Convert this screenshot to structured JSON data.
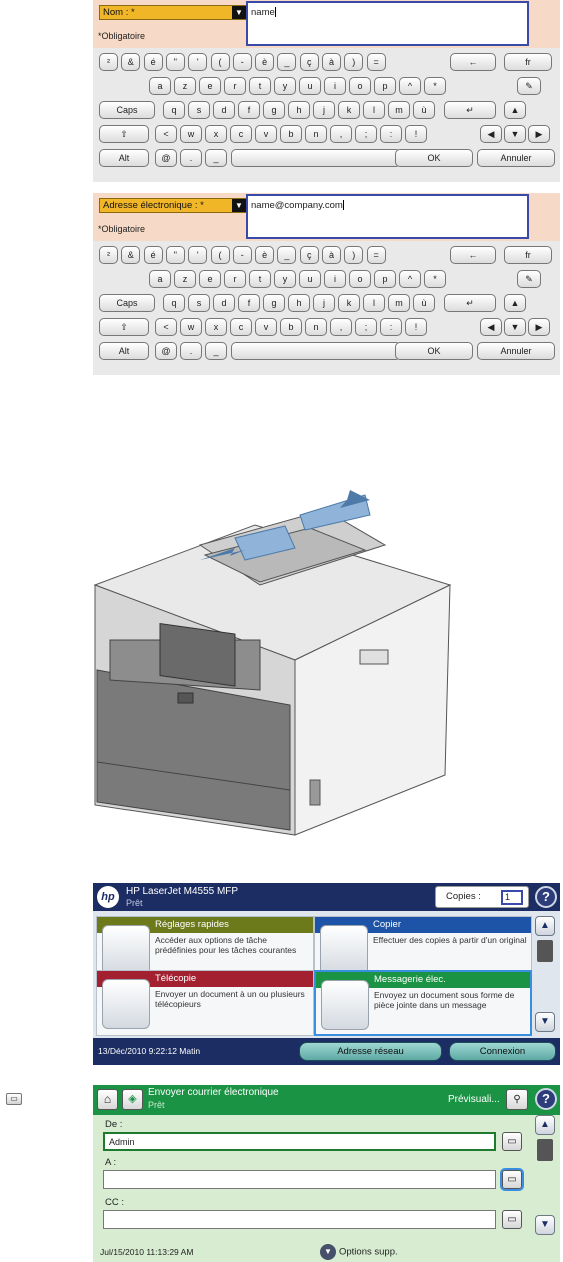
{
  "keyboard_panels": [
    {
      "field_label": "Nom : *",
      "field_value": "name",
      "required_note": "*Obligatoire"
    },
    {
      "field_label": "Adresse électronique : *",
      "field_value": "name@company.com",
      "required_note": "*Obligatoire"
    }
  ],
  "keyboard": {
    "row1": [
      "²",
      "&",
      "é",
      "\"",
      "'",
      "(",
      "-",
      "è",
      "_",
      "ç",
      "à",
      ")",
      "="
    ],
    "backspace": "←",
    "lang": "fr",
    "row2": [
      "a",
      "z",
      "e",
      "r",
      "t",
      "y",
      "u",
      "i",
      "o",
      "p",
      "^",
      "*"
    ],
    "caps": "Caps",
    "row3": [
      "q",
      "s",
      "d",
      "f",
      "g",
      "h",
      "j",
      "k",
      "l",
      "m",
      "ù"
    ],
    "enter": "↵",
    "shift": "⇧",
    "row4": [
      "<",
      "w",
      "x",
      "c",
      "v",
      "b",
      "n",
      ",",
      ";",
      ":",
      "!"
    ],
    "alt": "Alt",
    "row5": [
      "@",
      ".",
      "_"
    ],
    "ok": "OK",
    "cancel": "Annuler",
    "arrows": {
      "up": "▲",
      "left": "◀",
      "down": "▼",
      "right": "▶"
    }
  },
  "home_screen": {
    "device": "HP LaserJet M4555 MFP",
    "status": "Prêt",
    "copies_label": "Copies :",
    "copies_value": "1",
    "help": "?",
    "tiles": [
      {
        "title": "Réglages rapides",
        "desc": "Accéder aux options de tâche prédéfinies pour les tâches courantes",
        "color": "#6d7a1c"
      },
      {
        "title": "Copier",
        "desc": "Effectuer des copies à partir d'un original",
        "color": "#1e54a8"
      },
      {
        "title": "Télécopie",
        "desc": "Envoyer un document à un ou plusieurs télécopieurs",
        "color": "#a22030"
      },
      {
        "title": "Messagerie élec.",
        "desc": "Envoyez un document sous forme de pièce jointe dans un message",
        "color": "#1b9344"
      }
    ],
    "datetime": "13/Déc/2010 9:22:12 Matin",
    "network_btn": "Adresse réseau",
    "login_btn": "Connexion"
  },
  "email_screen": {
    "title": "Envoyer courrier électronique",
    "status": "Prêt",
    "preview": "Prévisuali...",
    "from_label": "De :",
    "from_value": "Admin",
    "to_label": "A :",
    "to_value": "",
    "cc_label": "CC :",
    "cc_value": "",
    "datetime": "Jul/15/2010 11:13:29 AM",
    "more_options": "Options supp."
  }
}
